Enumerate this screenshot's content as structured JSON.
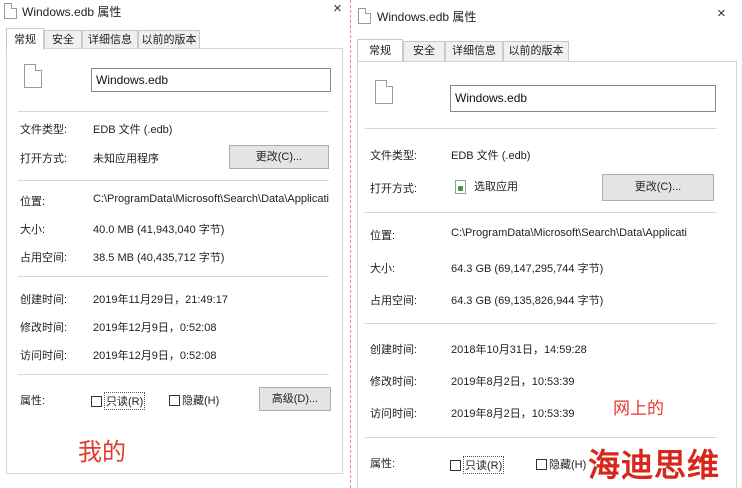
{
  "left_window": {
    "title": "Windows.edb 属性",
    "close_glyph": "×",
    "tabs": [
      "常规",
      "安全",
      "详细信息",
      "以前的版本"
    ],
    "filename": "Windows.edb",
    "file_type_label": "文件类型:",
    "file_type_value": "EDB 文件 (.edb)",
    "opens_with_label": "打开方式:",
    "opens_with_value": "未知应用程序",
    "change_button": "更改(C)...",
    "location_label": "位置:",
    "location_value": "C:\\ProgramData\\Microsoft\\Search\\Data\\Applicati",
    "size_label": "大小:",
    "size_value": "40.0 MB (41,943,040 字节)",
    "size_on_disk_label": "占用空间:",
    "size_on_disk_value": "38.5 MB (40,435,712 字节)",
    "created_label": "创建时间:",
    "created_value": "2019年11月29日，21:49:17",
    "modified_label": "修改时间:",
    "modified_value": "2019年12月9日，0:52:08",
    "accessed_label": "访问时间:",
    "accessed_value": "2019年12月9日，0:52:08",
    "attributes_label": "属性:",
    "readonly_label": "只读(R)",
    "hidden_label": "隐藏(H)",
    "advanced_button": "高级(D)..."
  },
  "right_window": {
    "title": "Windows.edb 属性",
    "close_glyph": "×",
    "tabs": [
      "常规",
      "安全",
      "详细信息",
      "以前的版本"
    ],
    "filename": "Windows.edb",
    "file_type_label": "文件类型:",
    "file_type_value": "EDB 文件 (.edb)",
    "opens_with_label": "打开方式:",
    "opens_with_value": "选取应用",
    "change_button": "更改(C)...",
    "location_label": "位置:",
    "location_value": "C:\\ProgramData\\Microsoft\\Search\\Data\\Applicati",
    "size_label": "大小:",
    "size_value": "64.3 GB (69,147,295,744 字节)",
    "size_on_disk_label": "占用空间:",
    "size_on_disk_value": "64.3 GB (69,135,826,944 字节)",
    "created_label": "创建时间:",
    "created_value": "2018年10月31日，14:59:28",
    "modified_label": "修改时间:",
    "modified_value": "2019年8月2日，10:53:39",
    "accessed_label": "访问时间:",
    "accessed_value": "2019年8月2日，10:53:39",
    "attributes_label": "属性:",
    "readonly_label": "只读(R)",
    "hidden_label": "隐藏(H)"
  },
  "annotations": {
    "mine": "我的",
    "online": "网上的",
    "watermark": "海迪思维"
  },
  "colors": {
    "annotation_red": "#e23b2e",
    "watermark_red": "#d9261c",
    "divider_dashed": "#e88a8a"
  }
}
